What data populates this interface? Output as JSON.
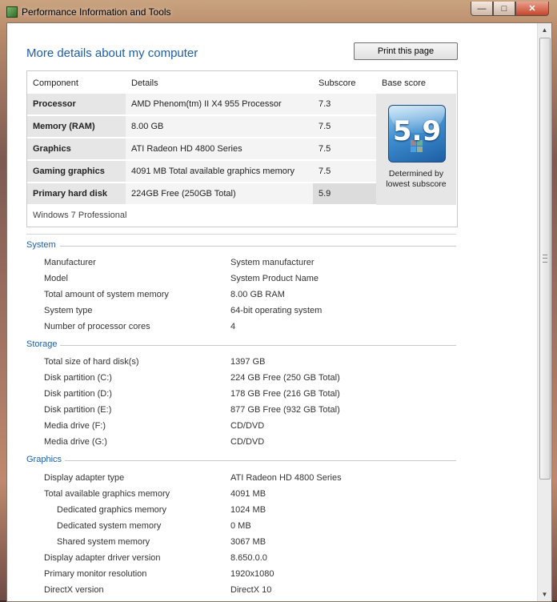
{
  "window": {
    "title": "Performance Information and Tools"
  },
  "header": {
    "title": "More details about my computer",
    "print_label": "Print this page"
  },
  "score_table": {
    "headers": {
      "component": "Component",
      "details": "Details",
      "subscore": "Subscore",
      "base": "Base score"
    },
    "rows": [
      {
        "component": "Processor",
        "details": "AMD Phenom(tm) II X4 955 Processor",
        "subscore": "7.3"
      },
      {
        "component": "Memory (RAM)",
        "details": "8.00 GB",
        "subscore": "7.5"
      },
      {
        "component": "Graphics",
        "details": "ATI Radeon HD 4800 Series",
        "subscore": "7.5"
      },
      {
        "component": "Gaming graphics",
        "details": "4091 MB Total available graphics memory",
        "subscore": "7.5"
      },
      {
        "component": "Primary hard disk",
        "details": "224GB Free (250GB Total)",
        "subscore": "5.9"
      }
    ],
    "base_score": "5.9",
    "base_note": "Determined by lowest subscore",
    "edition": "Windows 7 Professional"
  },
  "sections": {
    "system": {
      "title": "System",
      "items": [
        {
          "label": "Manufacturer",
          "value": "System manufacturer"
        },
        {
          "label": "Model",
          "value": "System Product Name"
        },
        {
          "label": "Total amount of system memory",
          "value": "8.00 GB RAM"
        },
        {
          "label": "System type",
          "value": "64-bit operating system"
        },
        {
          "label": "Number of processor cores",
          "value": "4"
        }
      ]
    },
    "storage": {
      "title": "Storage",
      "items": [
        {
          "label": "Total size of hard disk(s)",
          "value": "1397 GB"
        },
        {
          "label": "Disk partition (C:)",
          "value": "224 GB Free (250 GB Total)"
        },
        {
          "label": "Disk partition (D:)",
          "value": "178 GB Free (216 GB Total)"
        },
        {
          "label": "Disk partition (E:)",
          "value": "877 GB Free (932 GB Total)"
        },
        {
          "label": "Media drive (F:)",
          "value": "CD/DVD"
        },
        {
          "label": "Media drive (G:)",
          "value": "CD/DVD"
        }
      ]
    },
    "graphics": {
      "title": "Graphics",
      "items": [
        {
          "label": "Display adapter type",
          "value": "ATI Radeon HD 4800 Series"
        },
        {
          "label": "Total available graphics memory",
          "value": "4091 MB"
        },
        {
          "label": "Dedicated graphics memory",
          "value": "1024 MB"
        },
        {
          "label": "Dedicated system memory",
          "value": "0 MB"
        },
        {
          "label": "Shared system memory",
          "value": "3067 MB"
        },
        {
          "label": "Display adapter driver version",
          "value": "8.650.0.0"
        },
        {
          "label": "Primary monitor resolution",
          "value": "1920x1080"
        },
        {
          "label": "DirectX version",
          "value": "DirectX 10"
        }
      ]
    }
  },
  "icons": {
    "minimize": "minimize-icon",
    "maximize": "maximize-icon",
    "close": "close-icon",
    "app": "performance-app-icon"
  }
}
